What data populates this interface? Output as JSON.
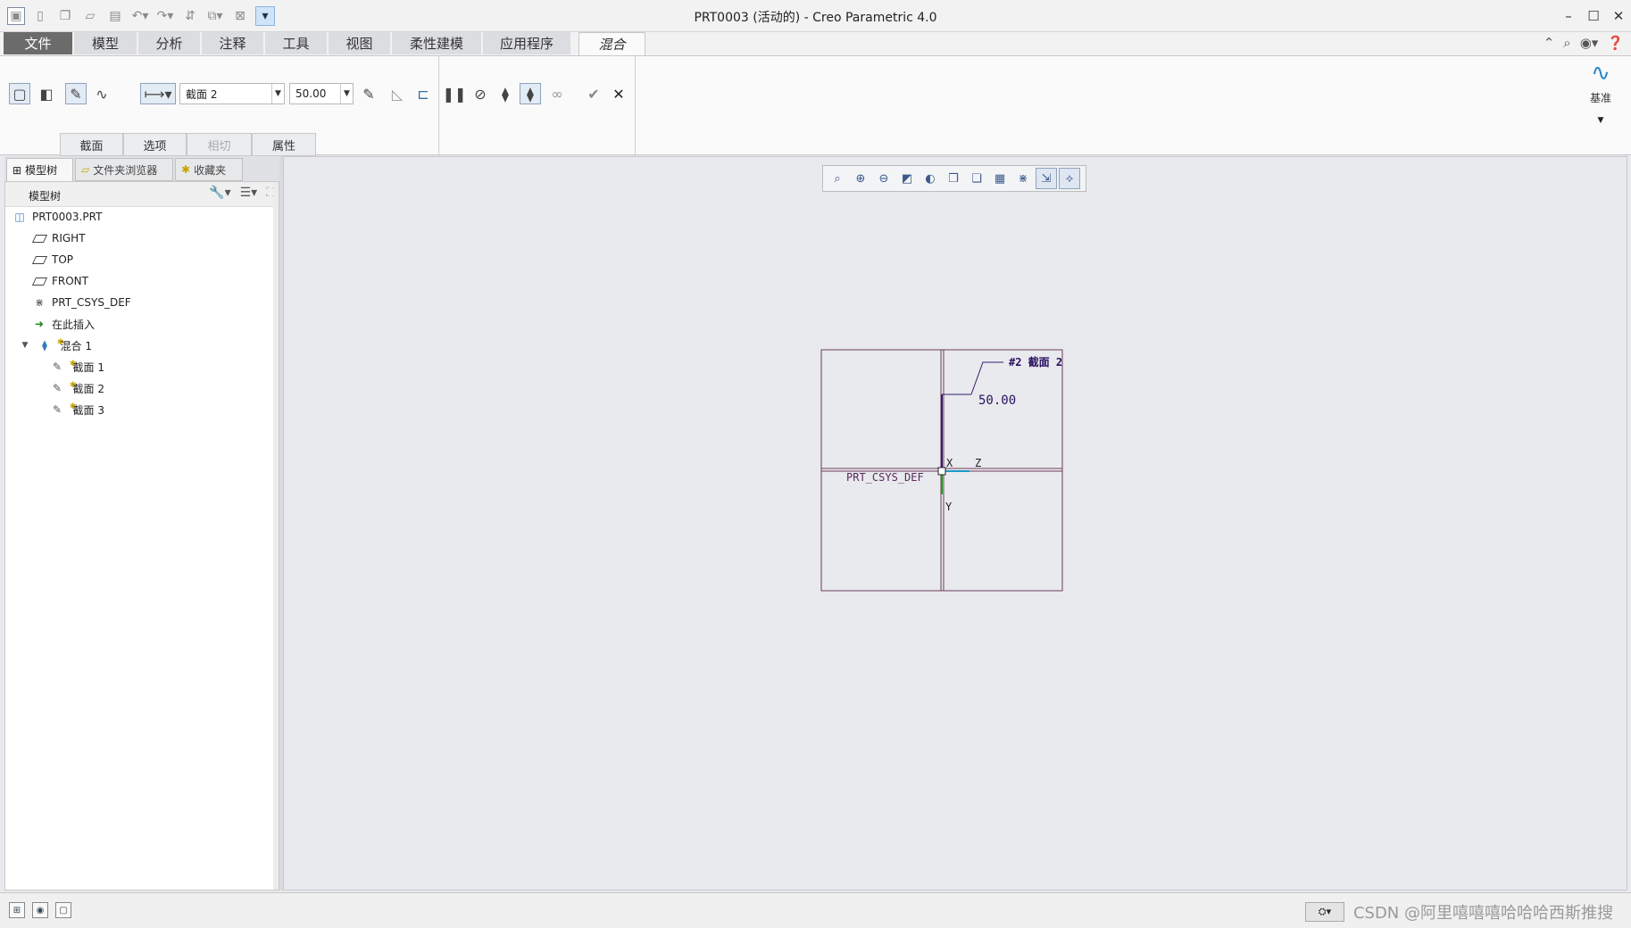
{
  "window": {
    "title": "PRT0003 (活动的) - Creo Parametric 4.0"
  },
  "ribbon_tabs": [
    "文件",
    "模型",
    "分析",
    "注释",
    "工具",
    "视图",
    "柔性建模",
    "应用程序",
    "混合"
  ],
  "ribbon": {
    "section_combo": "截面 2",
    "depth_combo": "50.00",
    "datum_label": "基准",
    "subtabs": [
      "截面",
      "选项",
      "相切",
      "属性"
    ]
  },
  "left_tabs": [
    "模型树",
    "文件夹浏览器",
    "收藏夹"
  ],
  "model_tree": {
    "header": "模型树",
    "root": "PRT0003.PRT",
    "items": [
      "RIGHT",
      "TOP",
      "FRONT",
      "PRT_CSYS_DEF",
      "在此插入",
      "混合 1",
      "截面 1",
      "截面 2",
      "截面 3"
    ]
  },
  "sketch": {
    "section_tag": "#2 截面 2",
    "dimension": "50.00",
    "csys_label": "PRT_CSYS_DEF",
    "axis_x": "X",
    "axis_z": "Z",
    "axis_y": "Y"
  },
  "watermark": "CSDN @阿里嘻嘻嘻哈哈哈西斯推搜"
}
